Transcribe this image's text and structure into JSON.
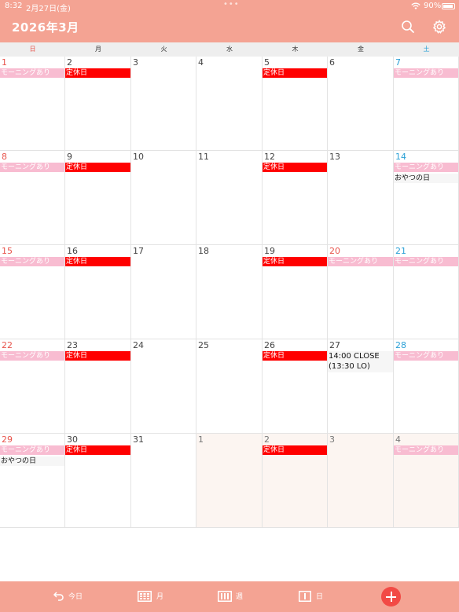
{
  "status_bar": {
    "time": "8:32",
    "date": "2月27日(金)",
    "battery": "90%"
  },
  "header": {
    "title": "2026年3月"
  },
  "weekdays": [
    "日",
    "月",
    "火",
    "水",
    "木",
    "金",
    "土"
  ],
  "weeks": [
    [
      {
        "day": "1",
        "type": "sun",
        "events": [
          {
            "label": "モーニングあり",
            "kind": "morning"
          }
        ]
      },
      {
        "day": "2",
        "type": "",
        "events": [
          {
            "label": "定休日",
            "kind": "closed"
          }
        ]
      },
      {
        "day": "3",
        "type": "",
        "events": []
      },
      {
        "day": "4",
        "type": "",
        "events": []
      },
      {
        "day": "5",
        "type": "",
        "events": [
          {
            "label": "定休日",
            "kind": "closed"
          }
        ]
      },
      {
        "day": "6",
        "type": "",
        "events": []
      },
      {
        "day": "7",
        "type": "sat",
        "events": [
          {
            "label": "モーニングあり",
            "kind": "morning"
          }
        ]
      }
    ],
    [
      {
        "day": "8",
        "type": "sun",
        "events": [
          {
            "label": "モーニングあり",
            "kind": "morning"
          }
        ]
      },
      {
        "day": "9",
        "type": "",
        "events": [
          {
            "label": "定休日",
            "kind": "closed"
          }
        ]
      },
      {
        "day": "10",
        "type": "",
        "events": []
      },
      {
        "day": "11",
        "type": "",
        "events": []
      },
      {
        "day": "12",
        "type": "",
        "events": [
          {
            "label": "定休日",
            "kind": "closed"
          }
        ]
      },
      {
        "day": "13",
        "type": "",
        "events": []
      },
      {
        "day": "14",
        "type": "sat",
        "events": [
          {
            "label": "モーニングあり",
            "kind": "morning"
          },
          {
            "label": "おやつの日",
            "kind": "plain"
          }
        ]
      }
    ],
    [
      {
        "day": "15",
        "type": "sun",
        "events": [
          {
            "label": "モーニングあり",
            "kind": "morning"
          }
        ]
      },
      {
        "day": "16",
        "type": "",
        "events": [
          {
            "label": "定休日",
            "kind": "closed"
          }
        ]
      },
      {
        "day": "17",
        "type": "",
        "events": []
      },
      {
        "day": "18",
        "type": "",
        "events": []
      },
      {
        "day": "19",
        "type": "",
        "events": [
          {
            "label": "定休日",
            "kind": "closed"
          }
        ]
      },
      {
        "day": "20",
        "type": "holiday",
        "events": [
          {
            "label": "モーニングあり",
            "kind": "morning"
          }
        ]
      },
      {
        "day": "21",
        "type": "sat",
        "events": [
          {
            "label": "モーニングあり",
            "kind": "morning"
          }
        ]
      }
    ],
    [
      {
        "day": "22",
        "type": "sun",
        "events": [
          {
            "label": "モーニングあり",
            "kind": "morning"
          }
        ]
      },
      {
        "day": "23",
        "type": "",
        "events": [
          {
            "label": "定休日",
            "kind": "closed"
          }
        ]
      },
      {
        "day": "24",
        "type": "",
        "events": []
      },
      {
        "day": "25",
        "type": "",
        "events": []
      },
      {
        "day": "26",
        "type": "",
        "events": [
          {
            "label": "定休日",
            "kind": "closed"
          }
        ]
      },
      {
        "day": "27",
        "type": "",
        "events": [
          {
            "label": "14:00 CLOSE (13:30 LO)",
            "kind": "plain2"
          }
        ]
      },
      {
        "day": "28",
        "type": "sat",
        "events": [
          {
            "label": "モーニングあり",
            "kind": "morning"
          }
        ]
      }
    ],
    [
      {
        "day": "29",
        "type": "sun",
        "events": [
          {
            "label": "モーニングあり",
            "kind": "morning"
          },
          {
            "label": "おやつの日",
            "kind": "plain"
          }
        ]
      },
      {
        "day": "30",
        "type": "",
        "events": [
          {
            "label": "定休日",
            "kind": "closed"
          }
        ]
      },
      {
        "day": "31",
        "type": "",
        "events": []
      },
      {
        "day": "1",
        "type": "muted",
        "next": true,
        "events": []
      },
      {
        "day": "2",
        "type": "muted",
        "next": true,
        "events": [
          {
            "label": "定休日",
            "kind": "closed"
          }
        ]
      },
      {
        "day": "3",
        "type": "muted",
        "next": true,
        "events": []
      },
      {
        "day": "4",
        "type": "muted",
        "next": true,
        "events": [
          {
            "label": "モーニングあり",
            "kind": "morning"
          }
        ]
      }
    ]
  ],
  "bottom_tabs": [
    {
      "id": "today",
      "label": "今日",
      "icon": "return-arrow-icon"
    },
    {
      "id": "month",
      "label": "月",
      "icon": "month-grid-icon"
    },
    {
      "id": "week",
      "label": "週",
      "icon": "week-columns-icon"
    },
    {
      "id": "day",
      "label": "日",
      "icon": "day-view-icon"
    }
  ],
  "colors": {
    "accent": "#f4a393",
    "closed": "#ff0000",
    "morning": "#f8bcd1",
    "add_button": "#f24a45",
    "sunday": "#e8554d",
    "saturday": "#2aa0d6"
  }
}
